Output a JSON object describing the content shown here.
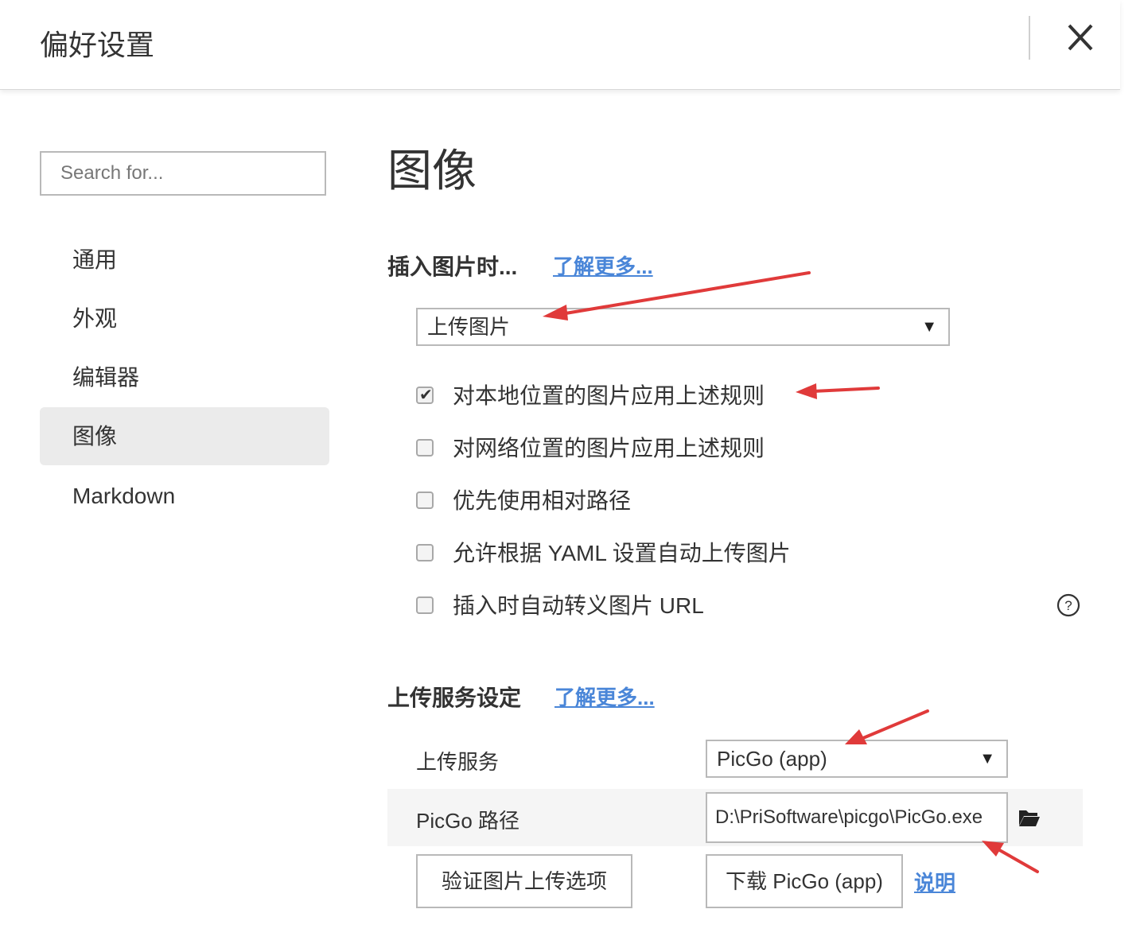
{
  "header": {
    "title": "偏好设置"
  },
  "search": {
    "placeholder": "Search for..."
  },
  "sidebar": {
    "items": [
      {
        "label": "通用"
      },
      {
        "label": "外观"
      },
      {
        "label": "编辑器"
      },
      {
        "label": "图像",
        "active": true
      },
      {
        "label": "Markdown"
      }
    ]
  },
  "main": {
    "title": "图像",
    "insert_section": {
      "title": "插入图片时...",
      "learn_more": "了解更多...",
      "action_select": "上传图片",
      "options": [
        {
          "label": "对本地位置的图片应用上述规则",
          "checked": true
        },
        {
          "label": "对网络位置的图片应用上述规则",
          "checked": false
        },
        {
          "label": "优先使用相对路径",
          "checked": false
        },
        {
          "label": "允许根据 YAML 设置自动上传图片",
          "checked": false
        },
        {
          "label": "插入时自动转义图片 URL",
          "checked": false
        }
      ]
    },
    "upload_section": {
      "title": "上传服务设定",
      "learn_more": "了解更多...",
      "service_label": "上传服务",
      "service_value": "PicGo (app)",
      "path_label": "PicGo 路径",
      "path_value": "D:\\PriSoftware\\picgo\\PicGo.exe",
      "verify_button": "验证图片上传选项",
      "download_button": "下载 PicGo (app)",
      "explain_link": "说明"
    }
  },
  "icons": {
    "close": "close-icon",
    "dropdown": "caret-down-icon",
    "help": "question-circle-icon",
    "folder": "folder-open-icon",
    "check": "checkmark-icon"
  },
  "colors": {
    "link": "#4a86d8",
    "annotation_arrow": "#e03a3a",
    "active_nav_bg": "#ebebeb"
  }
}
